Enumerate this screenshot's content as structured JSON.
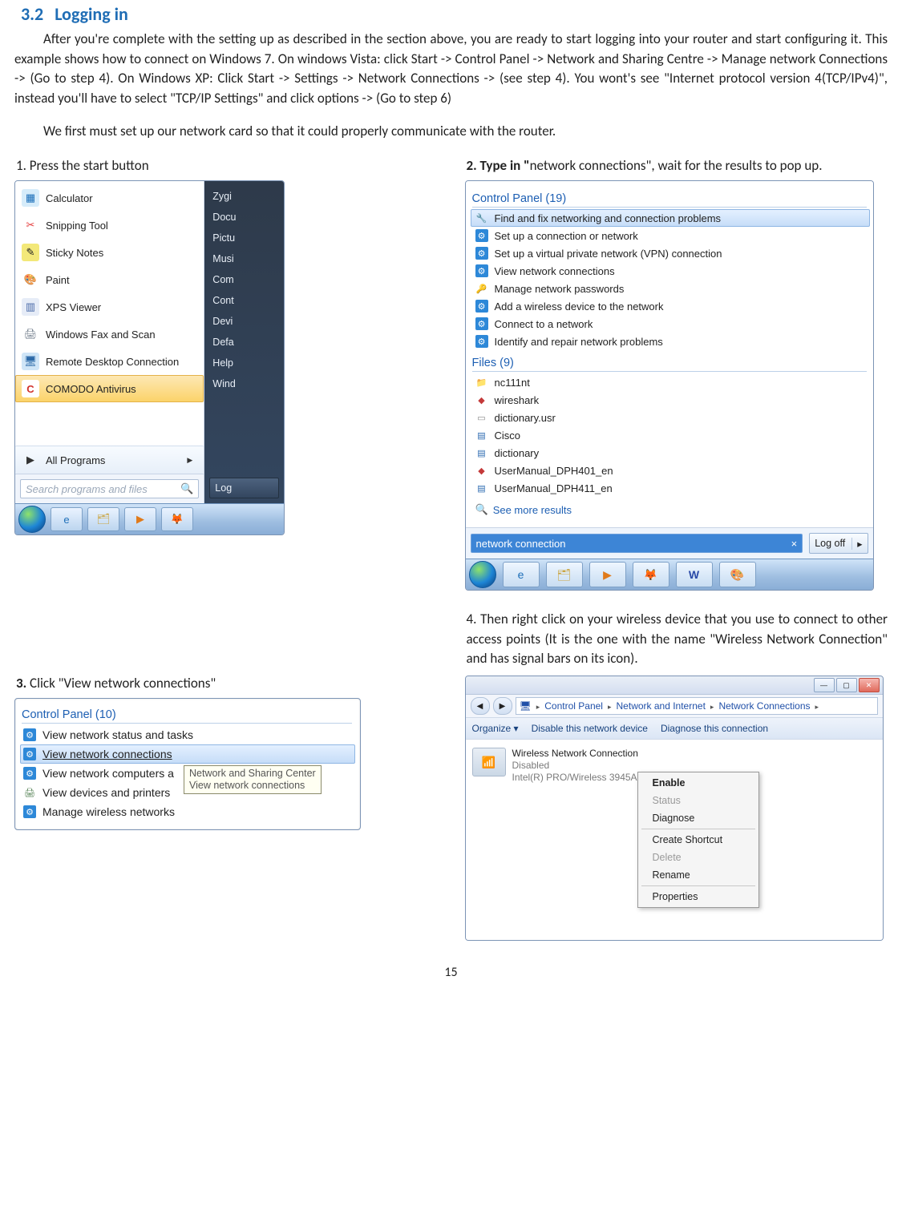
{
  "heading": {
    "number": "3.2",
    "title": "Logging in"
  },
  "para1": "After you're complete with the setting up as described in the section above, you are ready to start logging into your router and start configuring it. This example shows how to connect on Windows 7. On windows Vista: click Start -> Control Panel -> Network and Sharing Centre -> Manage network Connections -> (Go to step 4). On Windows XP: Click Start -> Settings -> Network Connections -> (see step 4). You wont's see \"Internet protocol version 4(TCP/IPv4)\", instead you'll have to select \"TCP/IP Settings\" and click options -> (Go to step 6)",
  "para2": "We first must set up our network card so that it could properly communicate with the router.",
  "step1_label": "1. Press the start button",
  "step2_label_a": "2. Type in \"",
  "step2_label_b": "network connections\", wait for the results to pop up.",
  "step3_label": "3. Click \"View network connections\"",
  "step4_label": "4. Then right click on your wireless device that you use to connect to other access points (It is the one with the name \"Wireless Network Connection\" and has signal bars on its icon).",
  "start_menu": {
    "left": [
      {
        "label": "Calculator",
        "color": "#3aa0e6"
      },
      {
        "label": "Snipping Tool",
        "color": "#e43b3b"
      },
      {
        "label": "Sticky Notes",
        "color": "#d8c23a"
      },
      {
        "label": "Paint",
        "color": "#4bb1e8"
      },
      {
        "label": "XPS Viewer",
        "color": "#6a8ad0"
      },
      {
        "label": "Windows Fax and Scan",
        "color": "#8a97a6"
      },
      {
        "label": "Remote Desktop Connection",
        "color": "#5aa0e0"
      }
    ],
    "highlight": "COMODO Antivirus",
    "all_programs": "All Programs",
    "search_placeholder": "Search programs and files",
    "right": [
      "Zygi",
      "Docu",
      "Pictu",
      "Musi",
      "Com",
      "Cont",
      "Devi",
      "Defa",
      "Help",
      "Wind"
    ],
    "right_btn": "Log"
  },
  "results": {
    "group1": "Control Panel (19)",
    "items1": [
      "Find and fix networking and connection problems",
      "Set up a connection or network",
      "Set up a virtual private network (VPN) connection",
      "View network connections",
      "Manage network passwords",
      "Add a wireless device to the network",
      "Connect to a network",
      "Identify and repair network problems"
    ],
    "group2": "Files (9)",
    "items2": [
      "nc111nt",
      "wireshark",
      "dictionary.usr",
      "Cisco",
      "dictionary",
      "UserManual_DPH401_en",
      "UserManual_DPH411_en"
    ],
    "more": "See more results",
    "query": "network connection",
    "logoff": "Log off"
  },
  "cp": {
    "header": "Control Panel (10)",
    "items": [
      "View network status and tasks",
      "View network connections",
      "View network computers a",
      "View devices and printers",
      "Manage wireless networks"
    ],
    "tooltip1": "Network and Sharing Center",
    "tooltip2": "View network connections"
  },
  "nc": {
    "crumb": [
      "Control Panel",
      "Network and Internet",
      "Network Connections"
    ],
    "org": "Organize ▾",
    "t1": "Disable this network device",
    "t2": "Diagnose this connection",
    "adapter": {
      "name": "Wireless Network Connection",
      "state": "Disabled",
      "dev": "Intel(R) PRO/Wireless 3945A..."
    },
    "ctx": [
      "Enable",
      "Status",
      "Diagnose",
      "Create Shortcut",
      "Delete",
      "Rename",
      "Properties"
    ]
  },
  "page_number": "15"
}
